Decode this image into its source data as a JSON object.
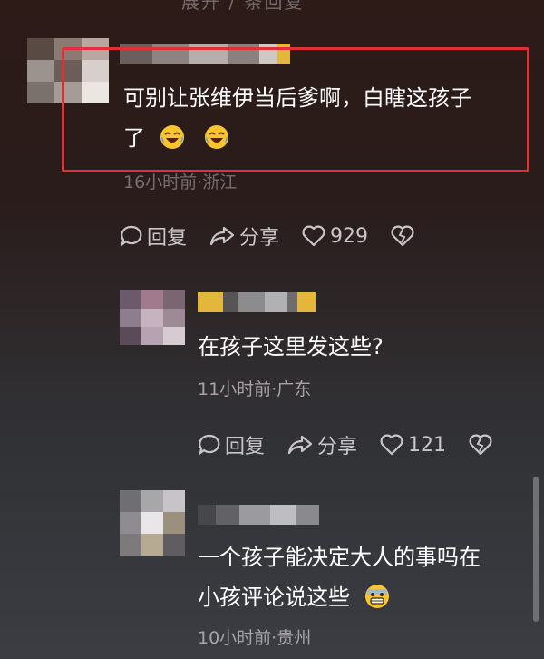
{
  "top_fragment": "展开 / 条回复",
  "comments": [
    {
      "text_line1": "可别让张维伊当后爹啊，白瞎这孩子",
      "text_line2": "了",
      "emoji_count": 2,
      "meta": "16小时前·浙江",
      "reply_label": "回复",
      "share_label": "分享",
      "like_count": "929"
    },
    {
      "text_line1": "在孩子这里发这些?",
      "meta": "11小时前·广东",
      "reply_label": "回复",
      "share_label": "分享",
      "like_count": "121"
    },
    {
      "text_line1": "一个孩子能决定大人的事吗在",
      "text_line2": "小孩评论说这些",
      "meta": "10小时前·贵州"
    }
  ],
  "colors": {
    "highlight": "#e0303a",
    "muted": "#a8a3a6"
  }
}
